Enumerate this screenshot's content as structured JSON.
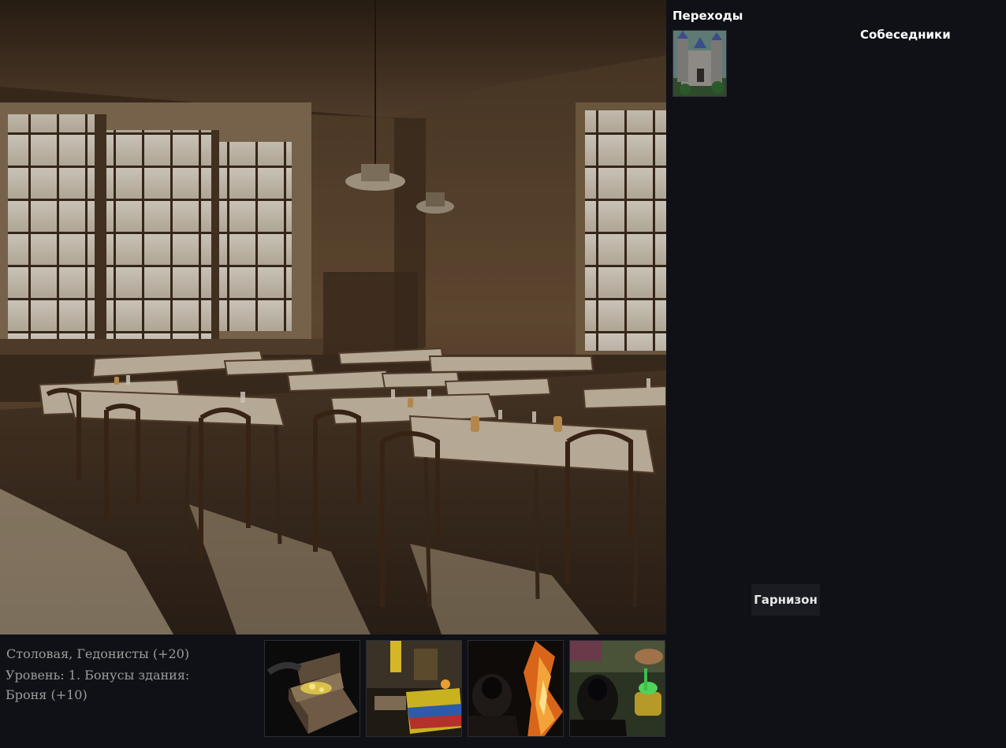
{
  "scene": {
    "icon": "dining-hall-scene"
  },
  "building": {
    "name": "Столовая, Гедонисты (+20)",
    "level_line": "Уровень: 1. Бонусы здания:",
    "bonus": "Броня (+10)"
  },
  "actions": [
    {
      "icon": "treasure-chest-icon"
    },
    {
      "icon": "merchant-stall-icon"
    },
    {
      "icon": "hooded-figure-fire-icon"
    },
    {
      "icon": "hooded-figure-cauldron-icon"
    }
  ],
  "transitions": {
    "title": "Переходы",
    "items": [
      {
        "icon": "castle-icon"
      }
    ]
  },
  "companions": {
    "title": "Собеседники"
  },
  "garrison": {
    "label": "Гарнизон"
  },
  "colors": {
    "background": "#0f1117",
    "info_text": "#9c9c9c",
    "heading_text": "#ffffff",
    "button_bg": "#1a1c22"
  }
}
